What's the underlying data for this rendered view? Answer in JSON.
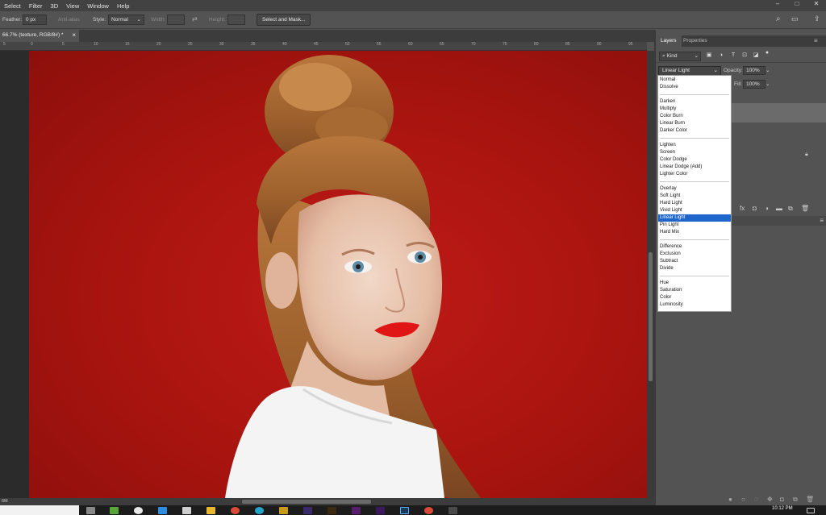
{
  "menubar": {
    "items": [
      "Select",
      "Filter",
      "3D",
      "View",
      "Window",
      "Help"
    ],
    "window_controls": [
      "–",
      "□",
      "✕"
    ]
  },
  "options": {
    "feather_label": "Feather:",
    "feather_value": "0 px",
    "antialias_label": "Anti-alias",
    "style_label": "Style:",
    "style_value": "Normal",
    "width_label": "Width:",
    "height_label": "Height:",
    "select_mask_label": "Select and Mask..."
  },
  "document": {
    "tab_title": "66.7% (texture, RGB/8#) *",
    "close": "×",
    "status_zoom": "6M"
  },
  "ruler": {
    "ticks": [
      "5",
      "0",
      "5",
      "10",
      "15",
      "20",
      "25",
      "30",
      "35",
      "40",
      "45",
      "50",
      "55",
      "60",
      "65",
      "70",
      "75",
      "80",
      "85",
      "90",
      "95"
    ]
  },
  "layers_panel": {
    "tabs": [
      "Layers",
      "Properties"
    ],
    "kind_label": "Kind",
    "blend_mode": "Linear Light",
    "opacity_label": "Opacity:",
    "opacity_value": "100%",
    "fill_label": "Fill:",
    "fill_value": "100%"
  },
  "blend_menu": {
    "groups": [
      [
        "Normal",
        "Dissolve"
      ],
      [
        "Darken",
        "Multiply",
        "Color Burn",
        "Linear Burn",
        "Darker Color"
      ],
      [
        "Lighten",
        "Screen",
        "Color Dodge",
        "Linear Dodge (Add)",
        "Lighter Color"
      ],
      [
        "Overlay",
        "Soft Light",
        "Hard Light",
        "Vivid Light",
        "Linear Light",
        "Pin Light",
        "Hard Mix"
      ],
      [
        "Difference",
        "Exclusion",
        "Subtract",
        "Divide"
      ],
      [
        "Hue",
        "Saturation",
        "Color",
        "Luminosity"
      ]
    ],
    "selected": "Linear Light"
  },
  "taskbar": {
    "time": "10:12 PM"
  },
  "colors": {
    "selection_blue": "#1f66cc",
    "backdrop_red": "#b3160f"
  }
}
